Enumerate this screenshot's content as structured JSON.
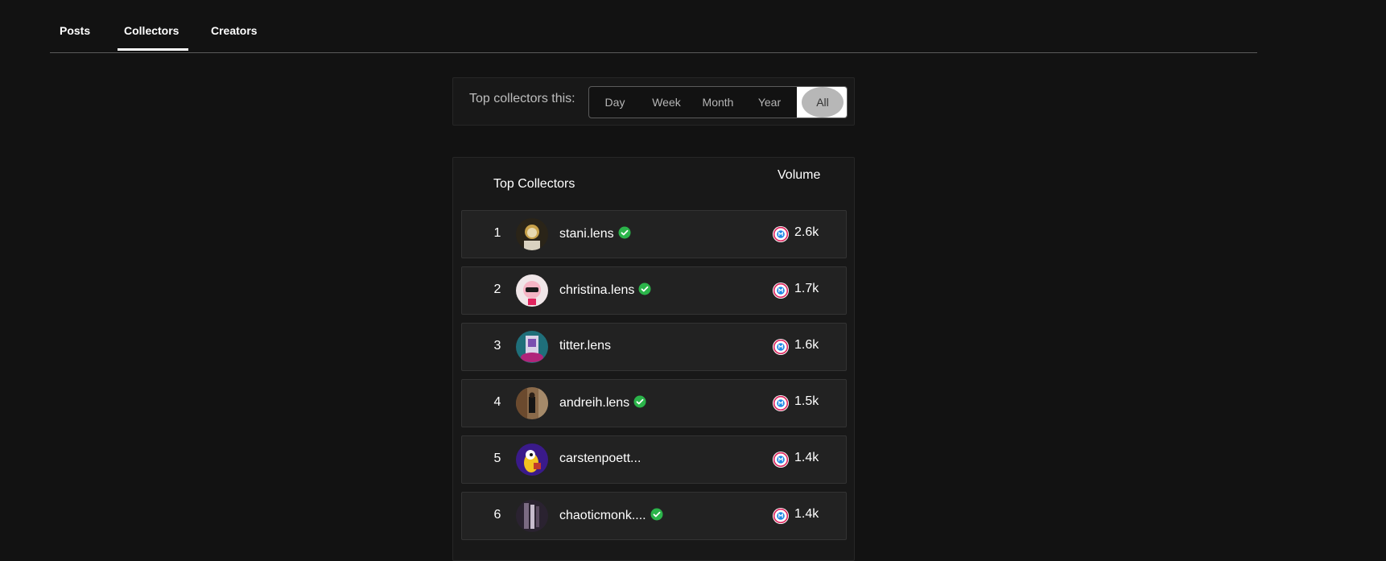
{
  "tabs": [
    {
      "label": "Posts"
    },
    {
      "label": "Collectors",
      "active": true
    },
    {
      "label": "Creators"
    }
  ],
  "filter": {
    "label": "Top collectors this:",
    "options": [
      "Day",
      "Week",
      "Month",
      "Year",
      "All"
    ],
    "selected": "All"
  },
  "leaderboard": {
    "title": "Top Collectors",
    "volume_header": "Volume",
    "rows": [
      {
        "rank": "1",
        "name": "stani.lens",
        "verified": true,
        "volume": "2.6k"
      },
      {
        "rank": "2",
        "name": "christina.lens",
        "verified": true,
        "volume": "1.7k"
      },
      {
        "rank": "3",
        "name": "titter.lens",
        "verified": false,
        "volume": "1.6k"
      },
      {
        "rank": "4",
        "name": "andreih.lens",
        "verified": true,
        "volume": "1.5k"
      },
      {
        "rank": "5",
        "name": "carstenpoett...",
        "verified": false,
        "volume": "1.4k"
      },
      {
        "rank": "6",
        "name": "chaoticmonk....",
        "verified": true,
        "volume": "1.4k"
      }
    ]
  },
  "colors": {
    "background": "#121212",
    "verified": "#2bb44a",
    "volume_icon_accent": "#e0245e",
    "volume_icon_center": "#1e88e5"
  },
  "icons": {
    "verified": "verified-check-icon",
    "volume": "collect-token-icon"
  }
}
